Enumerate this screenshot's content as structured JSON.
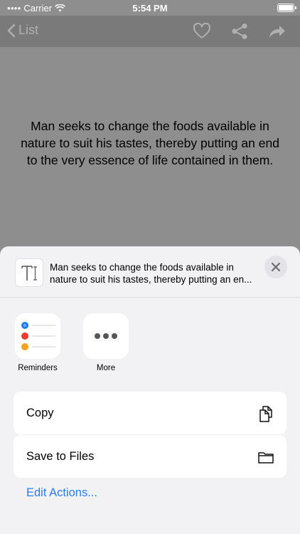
{
  "status_bar": {
    "carrier": "Carrier",
    "time": "5:54 PM"
  },
  "nav": {
    "back_label": "List",
    "icons": [
      "heart-icon",
      "share-icon",
      "forward-icon"
    ]
  },
  "quote": {
    "text": "Man seeks to change the foods available in nature to suit his tastes, thereby putting an end to the very essence of life contained in them."
  },
  "share_sheet": {
    "preview_text": "Man seeks to change the foods available in nature to suit his tastes, thereby putting an en...",
    "apps": [
      {
        "label": "Reminders",
        "icon": "reminders-icon"
      },
      {
        "label": "More",
        "icon": "more-icon"
      }
    ],
    "actions": [
      {
        "label": "Copy",
        "icon": "copy-icon"
      },
      {
        "label": "Save to Files",
        "icon": "folder-icon"
      }
    ],
    "edit_actions_label": "Edit Actions..."
  },
  "colors": {
    "overlay": "#8e8e8e",
    "sheet": "#f2f2f4",
    "link": "#2b7de9",
    "reminder_dots": [
      "#1e7cf2",
      "#ee3a30",
      "#f7a21b"
    ]
  }
}
